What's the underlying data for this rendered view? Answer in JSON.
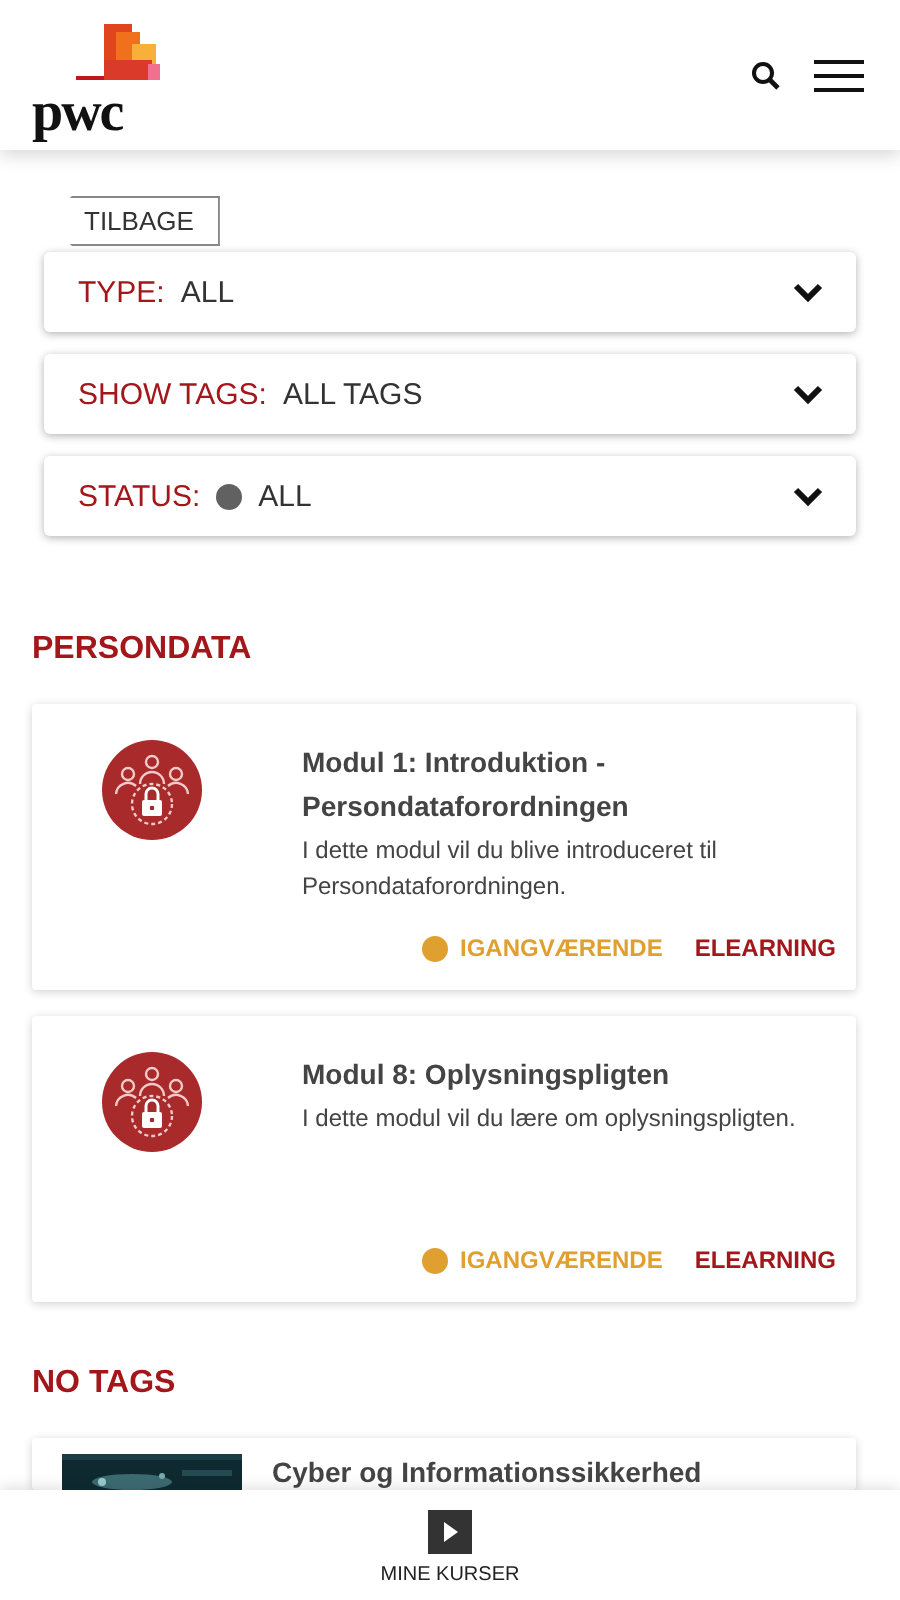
{
  "header": {
    "logo": "pwc"
  },
  "back_button": {
    "label": "TILBAGE"
  },
  "filters": [
    {
      "kind": "plain",
      "label": "TYPE:",
      "value": "ALL"
    },
    {
      "kind": "plain",
      "label": "SHOW TAGS:",
      "value": "ALL TAGS"
    },
    {
      "kind": "status",
      "label": "STATUS:",
      "value": "ALL",
      "color": "#616161"
    }
  ],
  "sections": [
    {
      "title": "PERSONDATA",
      "courses": [
        {
          "kind": "icon",
          "title": "Modul 1: Introduktion - Persondataforordningen",
          "description": "I dette modul vil du blive introduceret til Persondataforordningen.",
          "status": "IGANGVÆRENDE",
          "color": "#e0a030",
          "type": "ELEARNING"
        },
        {
          "kind": "icon",
          "title": "Modul 8: Oplysningspligten",
          "description": "I dette modul vil du lære om oplysningspligten.",
          "status": "IGANGVÆRENDE",
          "color": "#e0a030",
          "type": "ELEARNING"
        }
      ]
    },
    {
      "title": "NO TAGS",
      "courses": [
        {
          "kind": "picture",
          "title": "Cyber og Informationssikkerhed"
        }
      ]
    }
  ],
  "bottom_nav": {
    "label": "MINE KURSER"
  }
}
